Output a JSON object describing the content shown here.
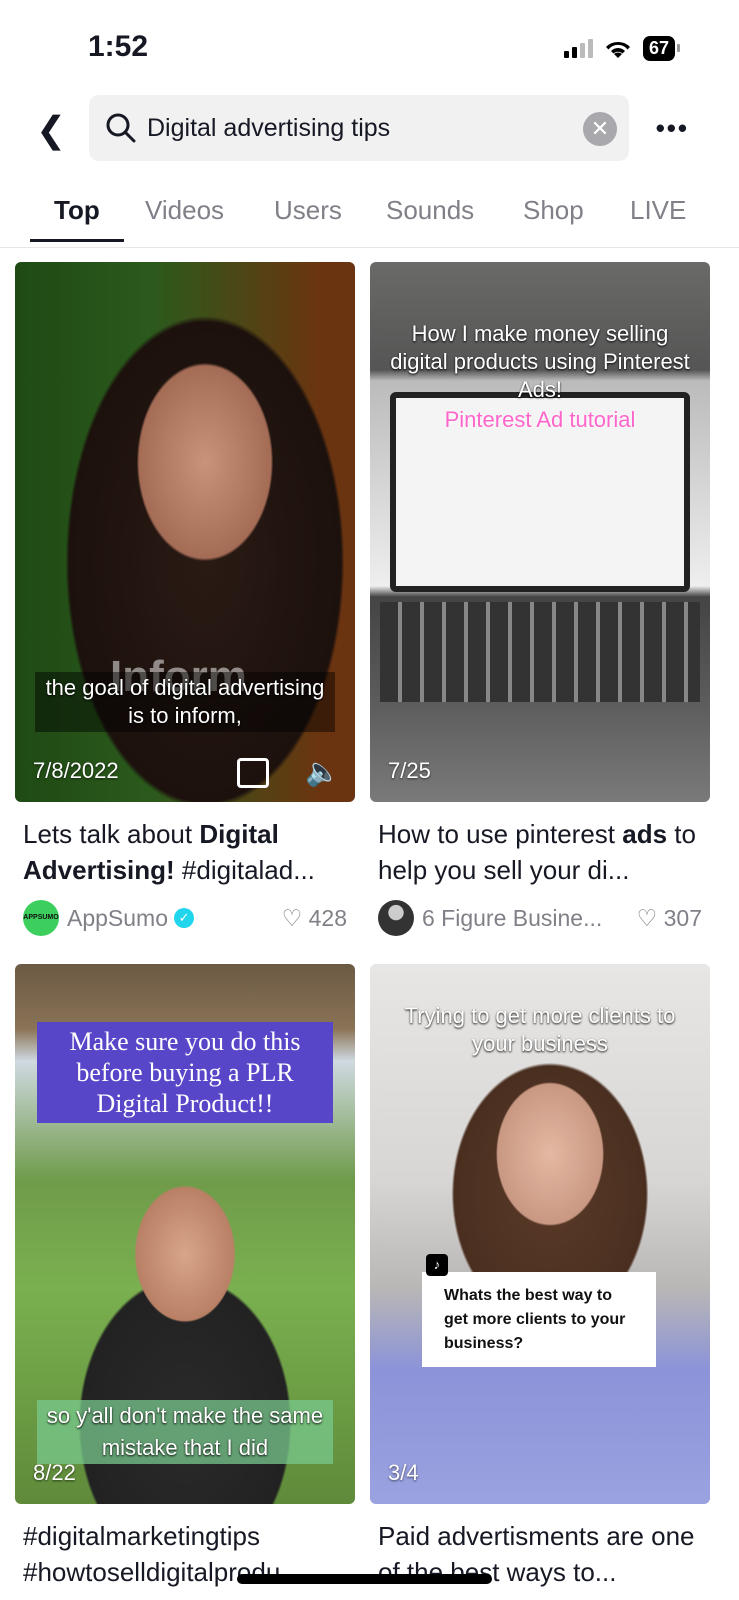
{
  "status": {
    "time": "1:52",
    "battery": "67"
  },
  "search": {
    "query": "Digital advertising tips"
  },
  "tabs": [
    "Top",
    "Videos",
    "Users",
    "Sounds",
    "Shop",
    "LIVE"
  ],
  "active_tab": "Top",
  "cards": [
    {
      "date": "7/8/2022",
      "overlay": "the goal of digital advertising is to inform,",
      "overlay_big": "Inform",
      "title_pre": "Lets talk about ",
      "title_bold": "Digital Advertising!",
      "title_post": " #digitalad...",
      "author": "AppSumo",
      "verified": true,
      "likes": "428",
      "avatar_text": "APPSUMO"
    },
    {
      "date": "7/25",
      "overlay": "How I make money selling digital products using Pinterest Ads!",
      "overlay2": "Pinterest Ad tutorial",
      "title_pre": "How to use pinterest ",
      "title_bold": "ads",
      "title_post": " to help you sell your di...",
      "author": "6 Figure Busine...",
      "likes": "307"
    },
    {
      "date": "8/22",
      "overlay": "Make sure you do this before buying a PLR Digital Product!!",
      "overlay2": "so y'all don't make the same mistake that I did",
      "title_pre": "#digitalmarketingtips #howtoselldigitalprodu...",
      "title_bold": "",
      "title_post": ""
    },
    {
      "date": "3/4",
      "overlay": "Trying to get more clients to your business",
      "overlay2": "Whats the best way to get more clients to your business?",
      "title_pre": "Paid advertisments are one of the best ways to...",
      "title_bold": "",
      "title_post": ""
    }
  ],
  "colors": {
    "verified": "#20d5ec",
    "appsumo": "#3ccf5e",
    "caption_box": "#5846c9"
  }
}
